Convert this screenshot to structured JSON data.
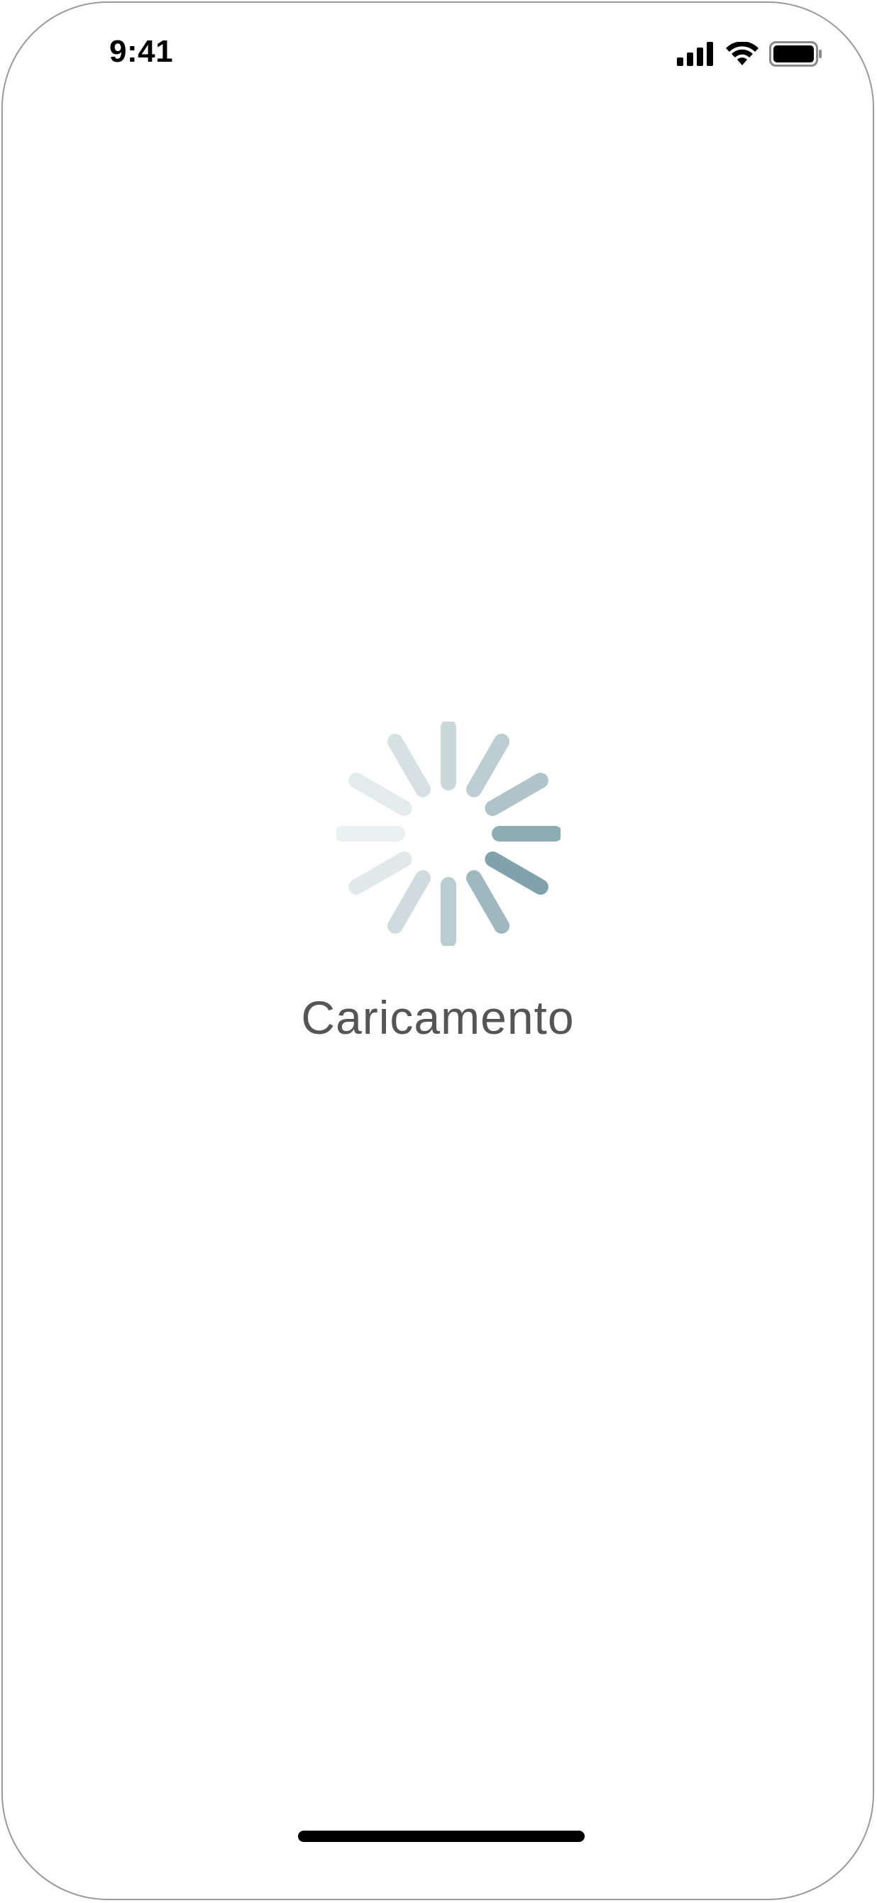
{
  "status_bar": {
    "time": "9:41",
    "icons": [
      "signal-icon",
      "wifi-icon",
      "battery-icon"
    ]
  },
  "loading": {
    "label": "Caricamento",
    "spinner_color": "#7b9ea8",
    "spinner_icon": "activity-indicator-icon"
  },
  "colors": {
    "text_secondary": "#555555",
    "home_indicator": "#000000"
  }
}
